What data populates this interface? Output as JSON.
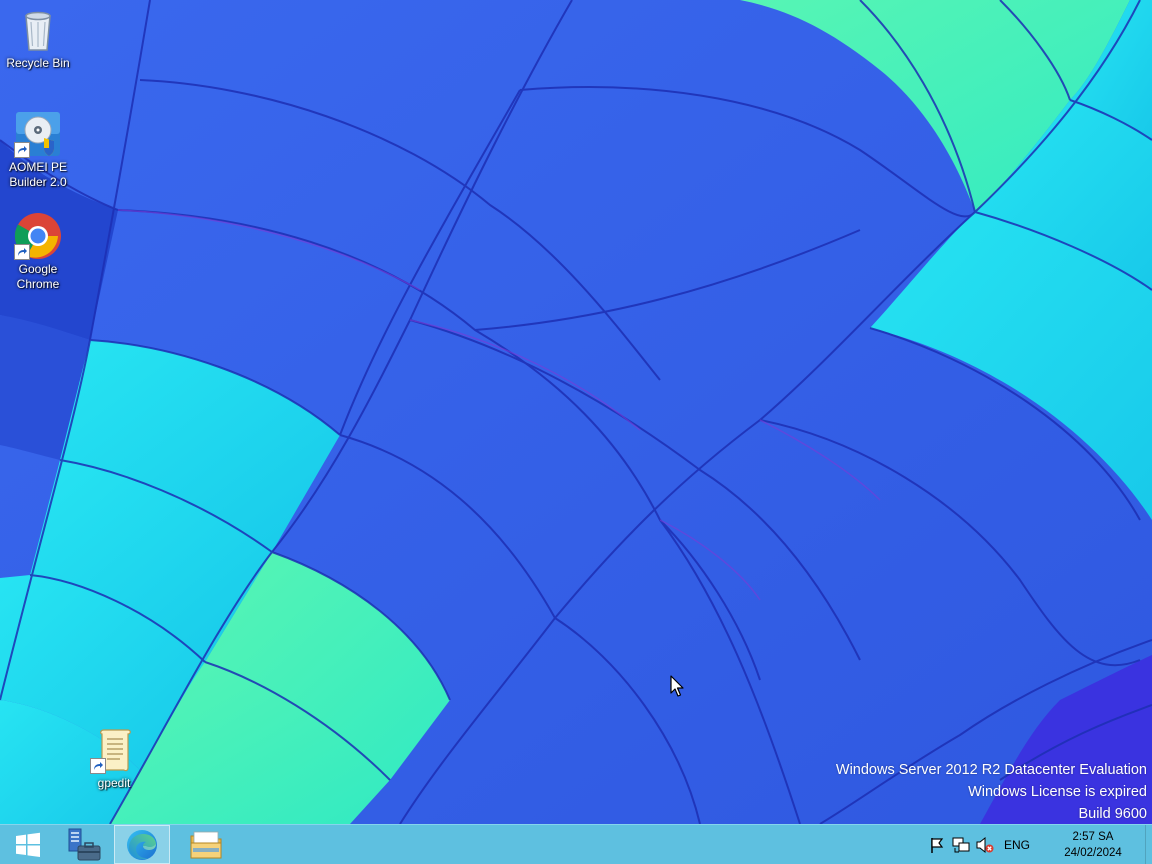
{
  "desktop": {
    "icons": [
      {
        "label": "Recycle Bin",
        "icon": "recycle-bin-icon"
      },
      {
        "label": "AOMEI PE Builder 2.0",
        "icon": "aomei-pe-builder-icon"
      },
      {
        "label": "Google Chrome",
        "icon": "chrome-icon"
      },
      {
        "label": "gpedit",
        "icon": "gpedit-icon"
      }
    ],
    "watermark": {
      "line1": "Windows Server 2012 R2 Datacenter Evaluation",
      "line2": "Windows License is expired",
      "line3": "Build 9600"
    }
  },
  "taskbar": {
    "buttons": [
      {
        "name": "start",
        "icon": "windows-logo-icon"
      },
      {
        "name": "server-manager",
        "icon": "server-manager-icon"
      },
      {
        "name": "edge",
        "icon": "edge-icon",
        "active": true
      },
      {
        "name": "file-explorer",
        "icon": "folder-icon"
      }
    ],
    "tray": {
      "icons": [
        "action-center-flag-icon",
        "network-icon",
        "volume-muted-icon"
      ],
      "language": "ENG",
      "time": "2:57 SA",
      "date": "24/02/2024"
    }
  },
  "colors": {
    "taskbar": "#5ec0e0",
    "wallpaper_blue": "#2f5ce8",
    "wallpaper_cyan": "#1ee3f0",
    "wallpaper_green": "#4ef2b8"
  }
}
